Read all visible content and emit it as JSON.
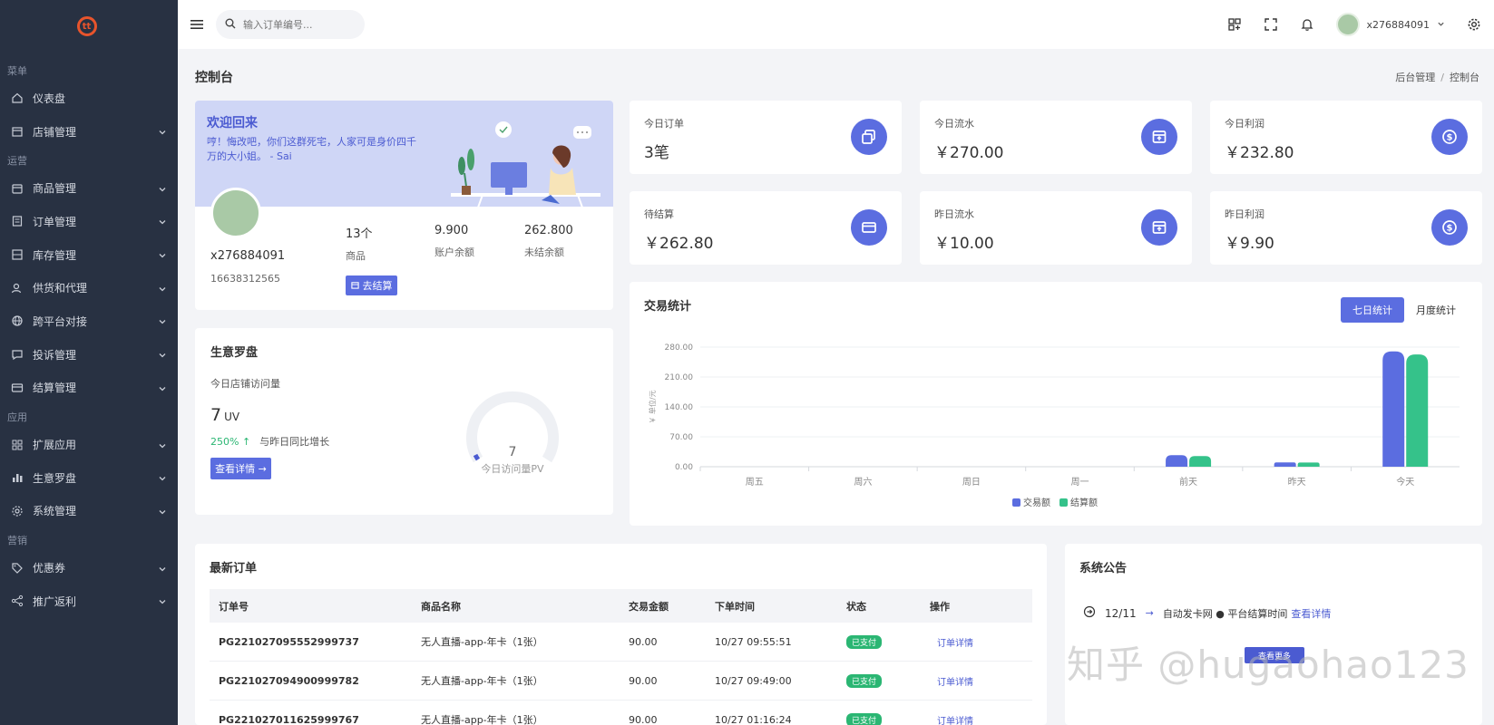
{
  "sidebar": {
    "logo_text": "tt",
    "sections": {
      "menu": "菜单",
      "ops": "运营",
      "apps": "应用",
      "marketing": "营销"
    },
    "items": [
      {
        "label": "仪表盘",
        "icon": "home-icon"
      },
      {
        "label": "店铺管理",
        "icon": "store-icon"
      },
      {
        "label": "商品管理",
        "icon": "box-icon"
      },
      {
        "label": "订单管理",
        "icon": "order-icon"
      },
      {
        "label": "库存管理",
        "icon": "inventory-icon"
      },
      {
        "label": "供货和代理",
        "icon": "users-icon"
      },
      {
        "label": "跨平台对接",
        "icon": "globe-icon"
      },
      {
        "label": "投诉管理",
        "icon": "complaint-icon"
      },
      {
        "label": "结算管理",
        "icon": "card-icon"
      },
      {
        "label": "扩展应用",
        "icon": "apps-icon"
      },
      {
        "label": "生意罗盘",
        "icon": "bar-chart-icon"
      },
      {
        "label": "系统管理",
        "icon": "gear-icon"
      },
      {
        "label": "优惠券",
        "icon": "tag-icon"
      },
      {
        "label": "推广返利",
        "icon": "share-icon"
      }
    ]
  },
  "topbar": {
    "search_placeholder": "输入订单编号...",
    "username": "x276884091"
  },
  "page": {
    "title": "控制台",
    "breadcrumb": [
      "后台管理",
      "/",
      "控制台"
    ]
  },
  "welcome": {
    "title": "欢迎回来",
    "text": "哼！悔改吧，你们这群死宅，人家可是身价四千万的大小姐。 - Sai",
    "name": "x276884091",
    "phone": "16638312565",
    "stats": [
      {
        "value": "13个",
        "label": "商品"
      },
      {
        "value": "9.900",
        "label": "账户余额"
      },
      {
        "value": "262.800",
        "label": "未结余额"
      }
    ],
    "settle_button": "去结算"
  },
  "stat_cards": [
    {
      "label": "今日订单",
      "value": "3笔"
    },
    {
      "label": "今日流水",
      "value": "￥270.00"
    },
    {
      "label": "今日利润",
      "value": "￥232.80"
    },
    {
      "label": "待结算",
      "value": "￥262.80"
    },
    {
      "label": "昨日流水",
      "value": "￥10.00"
    },
    {
      "label": "昨日利润",
      "value": "￥9.90"
    }
  ],
  "compass": {
    "title": "生意罗盘",
    "subtitle": "今日店铺访问量",
    "uv_value": "7",
    "uv_unit": "UV",
    "growth": "250% ↑",
    "growth_label": "与昨日同比增长",
    "detail_button": "查看详情 →",
    "gauge_value": "7",
    "gauge_label": "今日访问量PV"
  },
  "trade": {
    "title": "交易统计",
    "tabs": [
      "七日统计",
      "月度统计"
    ],
    "colors": {
      "trade": "#5b6de0",
      "settle": "#35c28a"
    }
  },
  "chart_data": {
    "type": "bar",
    "categories": [
      "周五",
      "周六",
      "周日",
      "周一",
      "前天",
      "昨天",
      "今天"
    ],
    "series": [
      {
        "name": "交易额",
        "values": [
          0,
          0,
          0,
          0,
          27,
          10,
          270
        ]
      },
      {
        "name": "结算额",
        "values": [
          0,
          0,
          0,
          0,
          25,
          9.9,
          262.8
        ]
      }
    ],
    "ylabel": "￥ 单位/元",
    "ylim": [
      0,
      280
    ],
    "yticks": [
      "0.00",
      "70.00",
      "140.00",
      "210.00",
      "280.00"
    ],
    "legend": "bottom"
  },
  "orders": {
    "title": "最新订单",
    "headers": [
      "订单号",
      "商品名称",
      "交易金额",
      "下单时间",
      "状态",
      "操作"
    ],
    "rows": [
      {
        "id": "PG221027095552999737",
        "product": "无人直播-app-年卡（1张）",
        "amount": "90.00",
        "time": "10/27 09:55:51",
        "status": "已支付",
        "action": "订单详情"
      },
      {
        "id": "PG221027094900999782",
        "product": "无人直播-app-年卡（1张）",
        "amount": "90.00",
        "time": "10/27 09:49:00",
        "status": "已支付",
        "action": "订单详情"
      },
      {
        "id": "PG221027011625999767",
        "product": "无人直播-app-年卡（1张）",
        "amount": "90.00",
        "time": "10/27 01:16:24",
        "status": "已支付",
        "action": "订单详情"
      }
    ]
  },
  "notices": {
    "title": "系统公告",
    "date": "12/11",
    "text": "自动发卡网 ● 平台结算时间",
    "link": "查看详情",
    "more_button": "查看更多",
    "watermark": "知乎 @hugaohao123"
  }
}
